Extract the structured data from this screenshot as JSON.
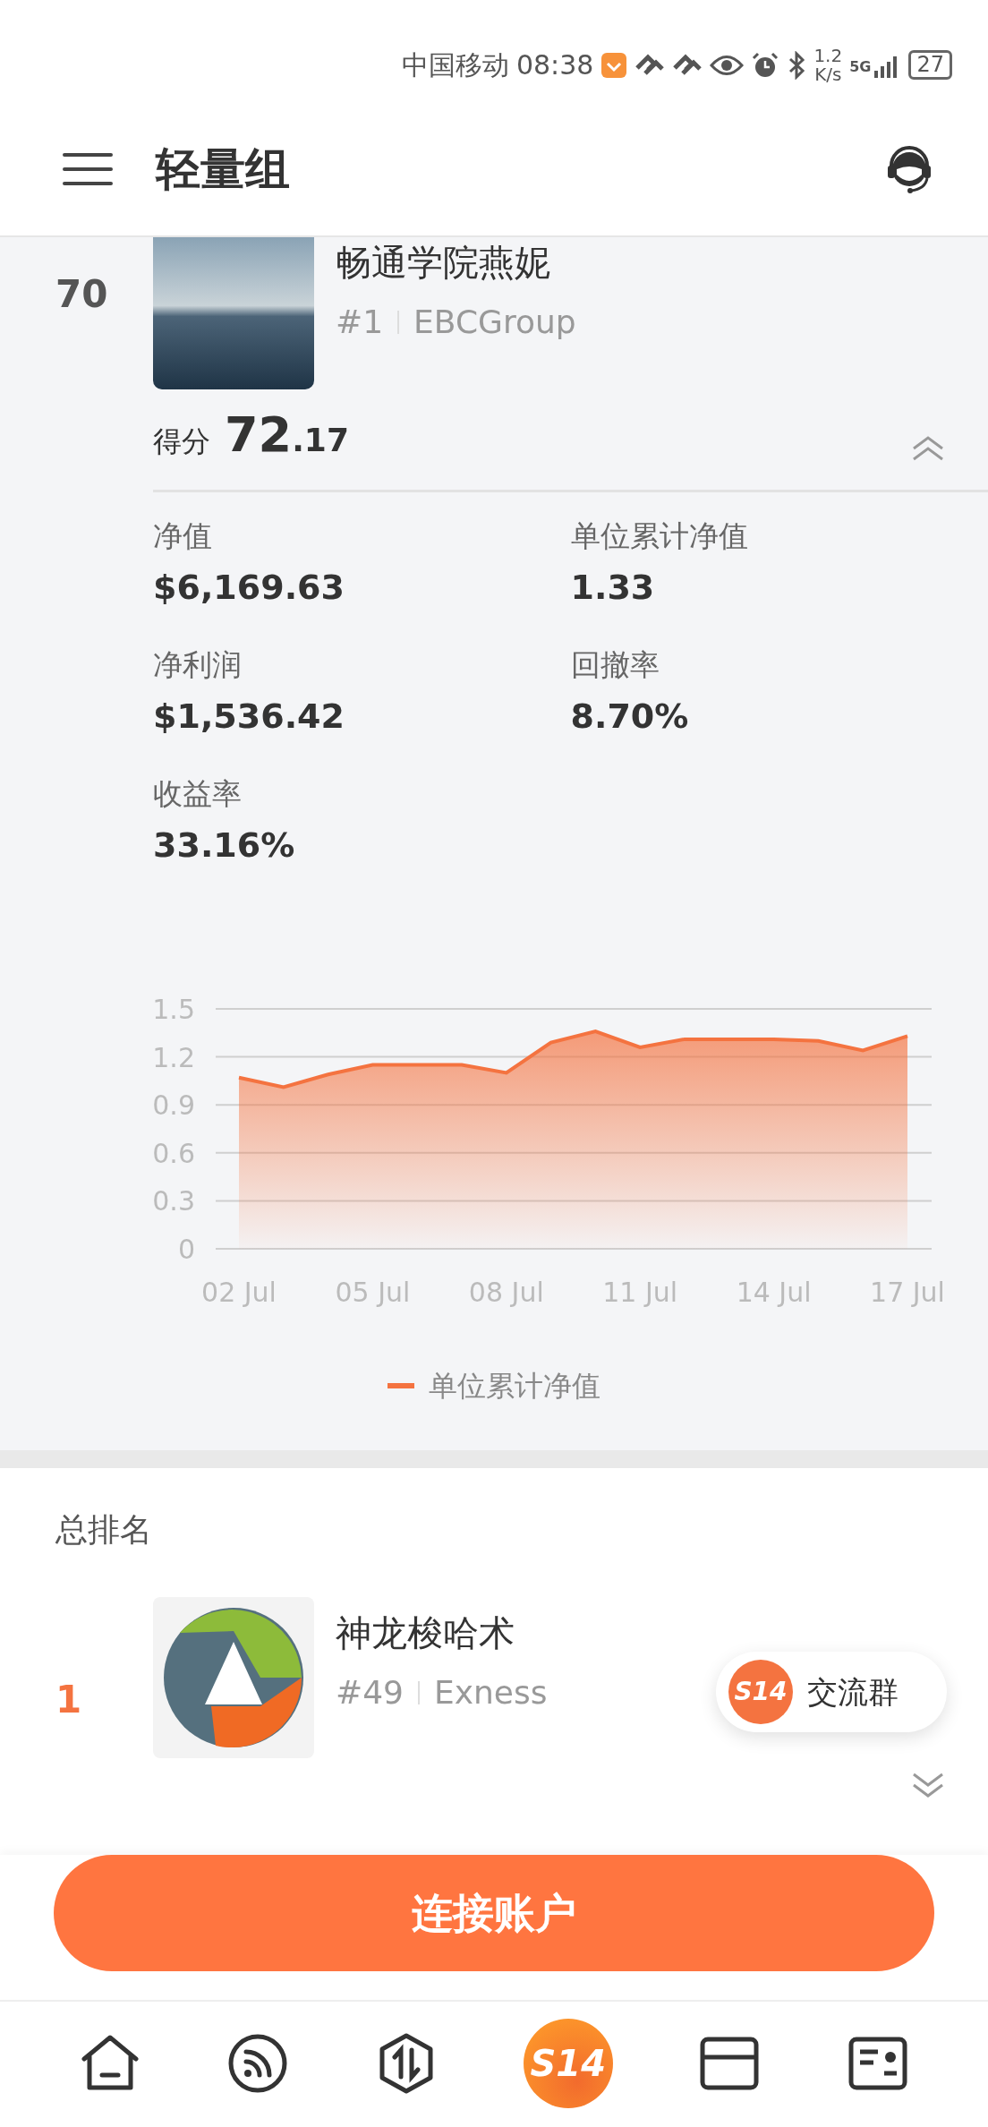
{
  "status_bar": {
    "carrier": "中国移动",
    "time": "08:38",
    "speed": "1.2",
    "speed_unit": "K/s",
    "network": "5G",
    "battery": "27"
  },
  "header": {
    "title": "轻量组"
  },
  "featured": {
    "rank": "70",
    "name": "畅通学院燕妮",
    "number": "#1",
    "broker": "EBCGroup",
    "score_label": "得分",
    "score_int": "72",
    "score_dec": ".17",
    "expanded": true,
    "metrics": [
      {
        "label": "净值",
        "value": "$6,169.63"
      },
      {
        "label": "单位累计净值",
        "value": "1.33"
      },
      {
        "label": "净利润",
        "value": "$1,536.42"
      },
      {
        "label": "回撤率",
        "value": "8.70%"
      },
      {
        "label": "收益率",
        "value": "33.16%"
      }
    ],
    "chart_data": {
      "type": "line",
      "categories": [
        "02 Jul",
        null,
        null,
        "05 Jul",
        null,
        null,
        "08 Jul",
        null,
        null,
        "11 Jul",
        null,
        null,
        "14 Jul",
        null,
        null,
        "17 Jul"
      ],
      "series": [
        {
          "name": "单位累计净值",
          "color": "#f47340",
          "values": [
            1.07,
            1.01,
            1.09,
            1.15,
            1.15,
            1.15,
            1.1,
            1.29,
            1.36,
            1.26,
            1.31,
            1.31,
            1.31,
            1.3,
            1.24,
            1.33
          ]
        }
      ],
      "ylim": [
        0,
        1.5
      ],
      "yticks": [
        0,
        0.3,
        0.6,
        0.9,
        1.2,
        1.5
      ],
      "grid": true
    }
  },
  "ranking": {
    "title": "总排名",
    "items": [
      {
        "rank": "1",
        "name": "神龙梭哈术",
        "number": "#49",
        "broker": "Exness",
        "expanded": false
      }
    ]
  },
  "floating_button": {
    "icon_text": "S14",
    "label": "交流群"
  },
  "connect_button": {
    "label": "连接账户"
  },
  "bottom_nav": [
    {
      "kind": "home"
    },
    {
      "kind": "feed"
    },
    {
      "kind": "exchange"
    },
    {
      "kind": "logo",
      "text": "S14"
    },
    {
      "kind": "card"
    },
    {
      "kind": "id"
    }
  ]
}
